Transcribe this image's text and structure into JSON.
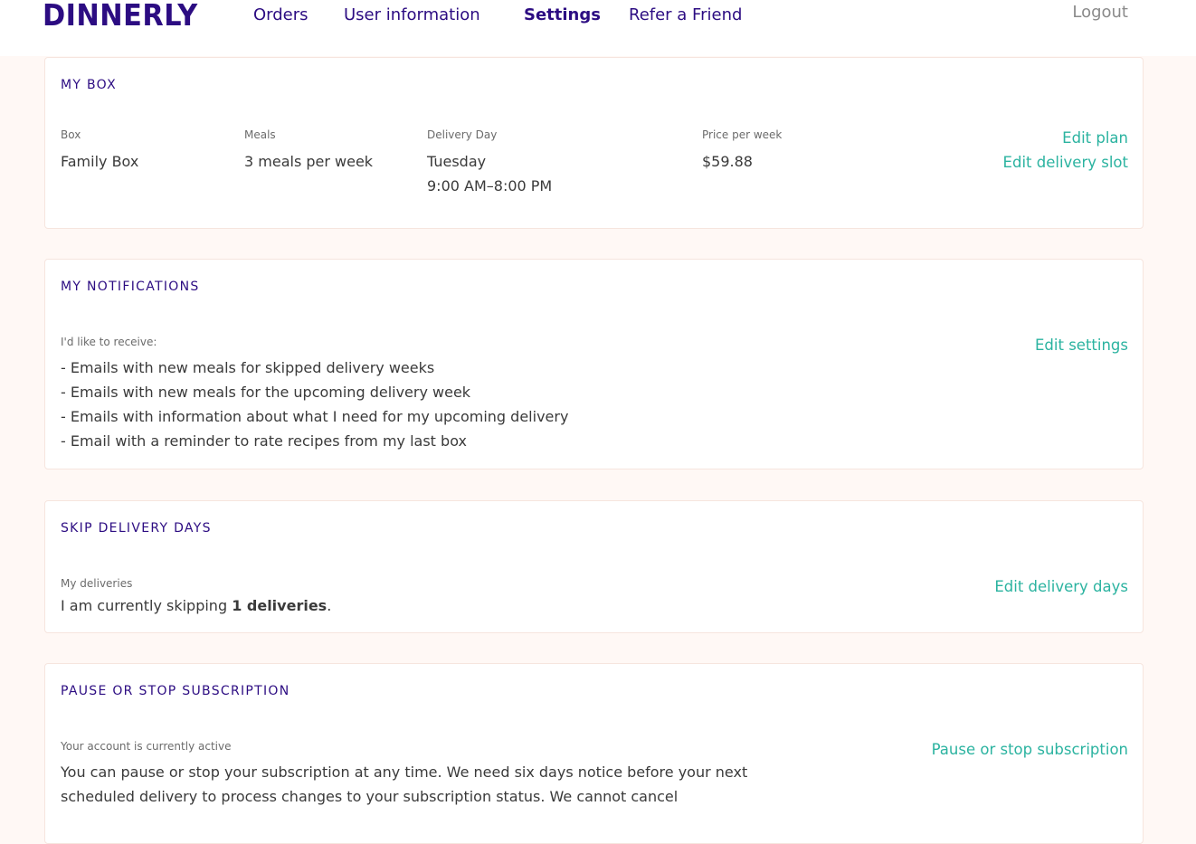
{
  "header": {
    "logo": "DINNERLY",
    "nav": [
      "Orders",
      "User information",
      "Settings",
      "Refer a Friend"
    ],
    "active_nav": "Settings",
    "logout": "Logout"
  },
  "my_box": {
    "title": "MY BOX",
    "box_label": "Box",
    "box_value": "Family Box",
    "meals_label": "Meals",
    "meals_value": "3 meals per week",
    "delivery_label": "Delivery Day",
    "delivery_day": "Tuesday",
    "delivery_time": "9:00 AM–8:00 PM",
    "price_label": "Price per week",
    "price_value": "$59.88",
    "edit_plan": "Edit plan",
    "edit_slot": "Edit delivery slot"
  },
  "notifications": {
    "title": "MY NOTIFICATIONS",
    "label": "I'd like to receive:",
    "items": [
      "- Emails with new meals for skipped delivery weeks",
      "- Emails with new meals for the upcoming delivery week",
      "- Emails with information about what I need for my upcoming delivery",
      "- Email with a reminder to rate recipes from my last box"
    ],
    "edit": "Edit settings"
  },
  "skip": {
    "title": "SKIP DELIVERY DAYS",
    "label": "My deliveries",
    "text_before": "I am currently skipping ",
    "count_text": "1 deliveries",
    "text_after": ".",
    "edit": "Edit delivery days"
  },
  "pause": {
    "title": "PAUSE OR STOP SUBSCRIPTION",
    "label": "Your account is currently active",
    "text": "You can pause or stop your subscription at any time. We need six days notice before your next scheduled delivery to process changes to your subscription status. We cannot cancel",
    "edit": "Pause or stop subscription"
  },
  "colors": {
    "brand": "#2c0c82",
    "link": "#2bb3a0",
    "background": "#fff8f5"
  }
}
